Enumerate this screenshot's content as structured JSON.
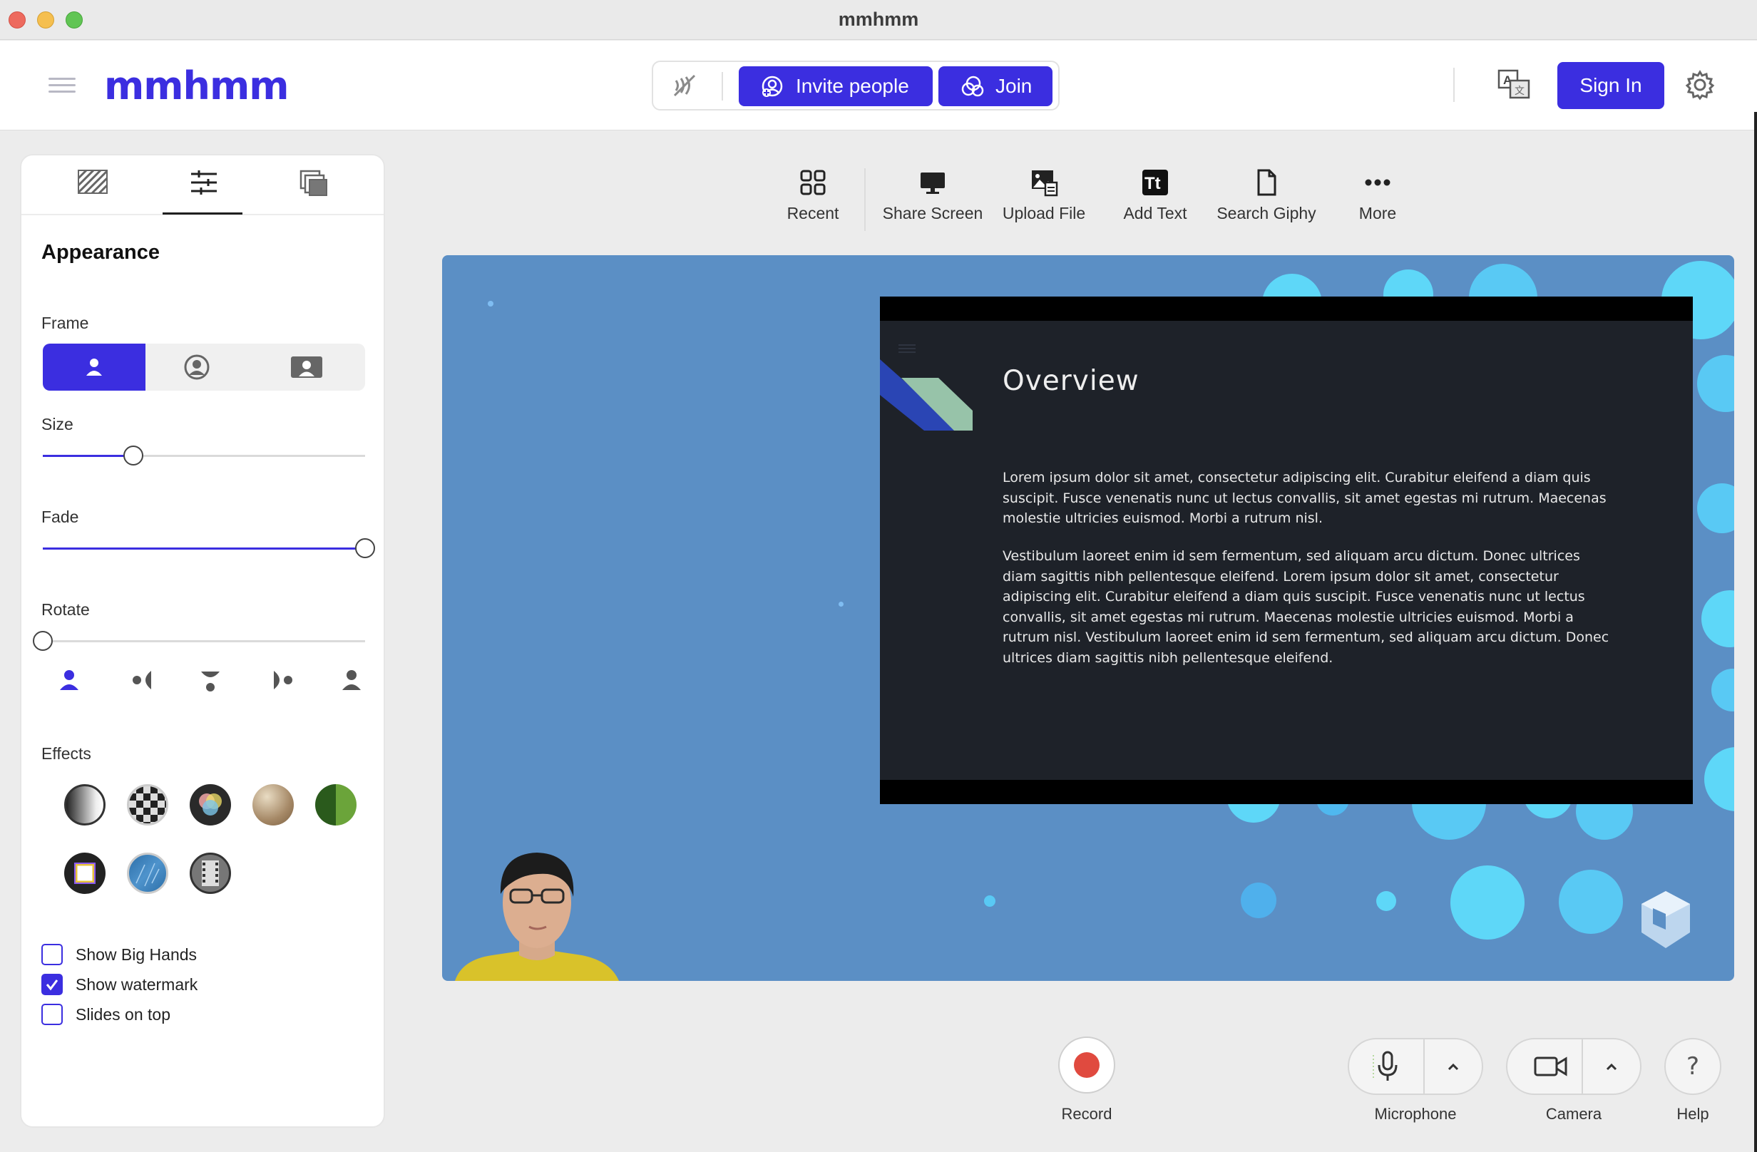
{
  "window": {
    "title": "mmhmm"
  },
  "header": {
    "logo": "mmhmm",
    "invite_label": "Invite people",
    "join_label": "Join",
    "signin_label": "Sign In"
  },
  "panel": {
    "tabs": [
      "backgrounds-tab",
      "appearance-tab",
      "slides-tab"
    ],
    "active_tab": 1,
    "title": "Appearance",
    "frame_label": "Frame",
    "frame_options": [
      "silhouette",
      "circle",
      "rectangle"
    ],
    "frame_selected": 0,
    "size_label": "Size",
    "size_value": 0.28,
    "fade_label": "Fade",
    "fade_value": 1.0,
    "rotate_label": "Rotate",
    "rotate_value": 0.0,
    "effects_label": "Effects",
    "checkboxes": [
      {
        "label": "Show Big Hands",
        "checked": false
      },
      {
        "label": "Show watermark",
        "checked": true
      },
      {
        "label": "Slides on top",
        "checked": false
      }
    ]
  },
  "toolbar": {
    "items": [
      {
        "label": "Recent",
        "icon": "grid-icon"
      },
      {
        "label": "Share Screen",
        "icon": "monitor-icon"
      },
      {
        "label": "Upload File",
        "icon": "upload-file-icon"
      },
      {
        "label": "Add Text",
        "icon": "text-icon"
      },
      {
        "label": "Search Giphy",
        "icon": "file-icon"
      },
      {
        "label": "More",
        "icon": "more-icon"
      }
    ]
  },
  "slide": {
    "title": "Overview",
    "paragraph1": "Lorem ipsum dolor sit amet, consectetur adipiscing elit. Curabitur eleifend a diam quis suscipit. Fusce venenatis nunc ut lectus convallis, sit amet egestas mi rutrum. Maecenas molestie ultricies euismod. Morbi a rutrum nisl.",
    "paragraph2": "Vestibulum laoreet enim id sem fermentum, sed aliquam arcu dictum. Donec ultrices diam sagittis nibh pellentesque eleifend. Lorem ipsum dolor sit amet, consectetur adipiscing elit. Curabitur eleifend a diam quis suscipit. Fusce venenatis nunc ut lectus convallis, sit amet egestas mi rutrum. Maecenas molestie ultricies euismod. Morbi a rutrum nisl. Vestibulum laoreet enim id sem fermentum, sed aliquam arcu dictum. Donec ultrices diam sagittis nibh pellentesque eleifend."
  },
  "controls": {
    "record_label": "Record",
    "microphone_label": "Microphone",
    "camera_label": "Camera",
    "help_label": "Help",
    "help_glyph": "?"
  },
  "colors": {
    "accent": "#3b2ee0",
    "stage_bg": "#5b8fc5",
    "record": "#e04a3f"
  }
}
